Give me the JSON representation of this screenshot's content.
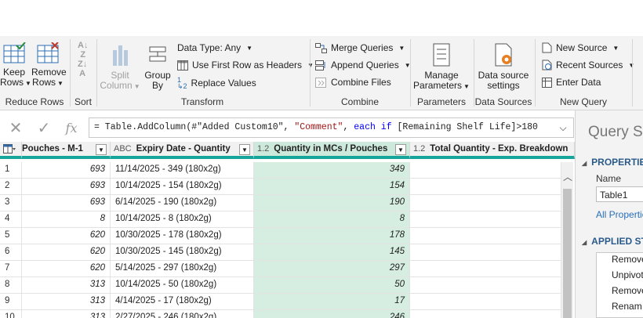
{
  "ribbon": {
    "groups": {
      "reduce_rows": "Reduce Rows",
      "sort": "Sort",
      "transform": "Transform",
      "combine": "Combine",
      "parameters": "Parameters",
      "data_sources": "Data Sources",
      "new_query": "New Query"
    },
    "keep_rows": [
      "Keep",
      "Rows"
    ],
    "remove_rows": [
      "Remove",
      "Rows"
    ],
    "split_column": [
      "Split",
      "Column"
    ],
    "group_by": [
      "Group",
      "By"
    ],
    "data_type": "Data Type: Any",
    "use_first_row": "Use First Row as Headers",
    "replace_values": "Replace Values",
    "merge_queries": "Merge Queries",
    "append_queries": "Append Queries",
    "combine_files": "Combine Files",
    "manage_parameters": [
      "Manage",
      "Parameters"
    ],
    "data_source_settings": [
      "Data source",
      "settings"
    ],
    "new_source": "New Source",
    "recent_sources": "Recent Sources",
    "enter_data": "Enter Data"
  },
  "formula": {
    "prefix": "= Table.AddColumn(#\"Added Custom10\", ",
    "string": "\"Comment\"",
    "sep": ", ",
    "kw1": "each",
    "sp": " ",
    "kw2": "if",
    "rest": " [Remaining Shelf Life]>180"
  },
  "columns": [
    {
      "name": "Pouches - M-1",
      "type": ""
    },
    {
      "name": "Expiry Date - Quantity",
      "type": "ABC"
    },
    {
      "name": "Quantity in MCs / Pouches",
      "type": "1.2"
    },
    {
      "name": "Total Quantity - Exp. Breakdown",
      "type": "1.2"
    }
  ],
  "rows": [
    {
      "i": "1",
      "m1": "693",
      "exp": "11/14/2025 - 349 (180x2g)",
      "qty": "349"
    },
    {
      "i": "2",
      "m1": "693",
      "exp": "10/14/2025 - 154 (180x2g)",
      "qty": "154"
    },
    {
      "i": "3",
      "m1": "693",
      "exp": "6/14/2025 - 190 (180x2g)",
      "qty": "190"
    },
    {
      "i": "4",
      "m1": "8",
      "exp": "10/14/2025 - 8 (180x2g)",
      "qty": "8"
    },
    {
      "i": "5",
      "m1": "620",
      "exp": "10/30/2025 - 178 (180x2g)",
      "qty": "178"
    },
    {
      "i": "6",
      "m1": "620",
      "exp": "10/30/2025 - 145 (180x2g)",
      "qty": "145"
    },
    {
      "i": "7",
      "m1": "620",
      "exp": "5/14/2025 - 297 (180x2g)",
      "qty": "297"
    },
    {
      "i": "8",
      "m1": "313",
      "exp": "10/14/2025 - 50 (180x2g)",
      "qty": "50"
    },
    {
      "i": "9",
      "m1": "313",
      "exp": "4/14/2025 - 17 (180x2g)",
      "qty": "17"
    },
    {
      "i": "10",
      "m1": "313",
      "exp": "2/27/2025 - 246 (180x2g)",
      "qty": "246"
    }
  ],
  "query_settings": {
    "title": "Query Se",
    "properties": "PROPERTIES",
    "name_label": "Name",
    "name_value": "Table1",
    "all_properties": "All Propertie",
    "applied_steps": "APPLIED ST",
    "steps": [
      "Remove",
      "Unpivot",
      "Remove",
      "Renam"
    ]
  },
  "colors": {
    "accent": "#15a59a",
    "selected": "#d6eee1",
    "link": "#2a6ebb"
  }
}
